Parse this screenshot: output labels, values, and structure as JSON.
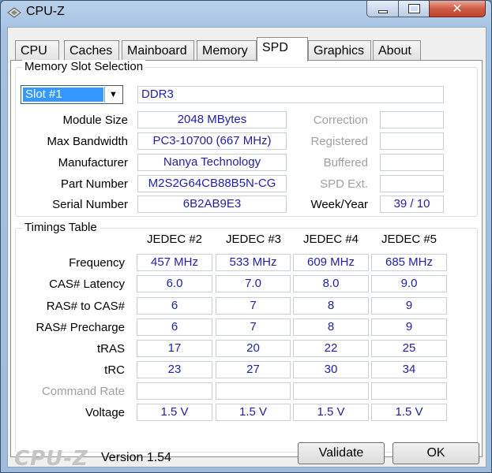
{
  "window": {
    "title": "CPU-Z",
    "close_glyph": "✕"
  },
  "tabs": [
    {
      "label": "CPU"
    },
    {
      "label": "Caches"
    },
    {
      "label": "Mainboard"
    },
    {
      "label": "Memory"
    },
    {
      "label": "SPD",
      "active": true
    },
    {
      "label": "Graphics"
    },
    {
      "label": "About"
    }
  ],
  "slot": {
    "group_label": "Memory Slot Selection",
    "selected": "Slot #1",
    "type": "DDR3",
    "rows": [
      {
        "label": "Module Size",
        "value": "2048 MBytes"
      },
      {
        "label": "Max Bandwidth",
        "value": "PC3-10700 (667 MHz)"
      },
      {
        "label": "Manufacturer",
        "value": "Nanya Technology"
      },
      {
        "label": "Part Number",
        "value": "M2S2G64CB88B5N-CG"
      },
      {
        "label": "Serial Number",
        "value": "6B2AB9E3"
      }
    ],
    "right_rows": [
      {
        "label": "Correction",
        "value": ""
      },
      {
        "label": "Registered",
        "value": ""
      },
      {
        "label": "Buffered",
        "value": ""
      },
      {
        "label": "SPD Ext.",
        "value": ""
      },
      {
        "label": "Week/Year",
        "value": "39 / 10"
      }
    ]
  },
  "timings": {
    "group_label": "Timings Table",
    "columns": [
      "JEDEC #2",
      "JEDEC #3",
      "JEDEC #4",
      "JEDEC #5"
    ],
    "rows": [
      {
        "label": "Frequency",
        "values": [
          "457 MHz",
          "533 MHz",
          "609 MHz",
          "685 MHz"
        ]
      },
      {
        "label": "CAS# Latency",
        "values": [
          "6.0",
          "7.0",
          "8.0",
          "9.0"
        ]
      },
      {
        "label": "RAS# to CAS#",
        "values": [
          "6",
          "7",
          "8",
          "9"
        ]
      },
      {
        "label": "RAS# Precharge",
        "values": [
          "6",
          "7",
          "8",
          "9"
        ]
      },
      {
        "label": "tRAS",
        "values": [
          "17",
          "20",
          "22",
          "25"
        ]
      },
      {
        "label": "tRC",
        "values": [
          "23",
          "27",
          "30",
          "34"
        ]
      },
      {
        "label": "Command Rate",
        "values": [
          "",
          "",
          "",
          ""
        ]
      },
      {
        "label": "Voltage",
        "values": [
          "1.5 V",
          "1.5 V",
          "1.5 V",
          "1.5 V"
        ]
      }
    ]
  },
  "footer": {
    "brand": "CPU-Z",
    "version": "Version 1.54",
    "validate_label": "Validate",
    "ok_label": "OK"
  }
}
